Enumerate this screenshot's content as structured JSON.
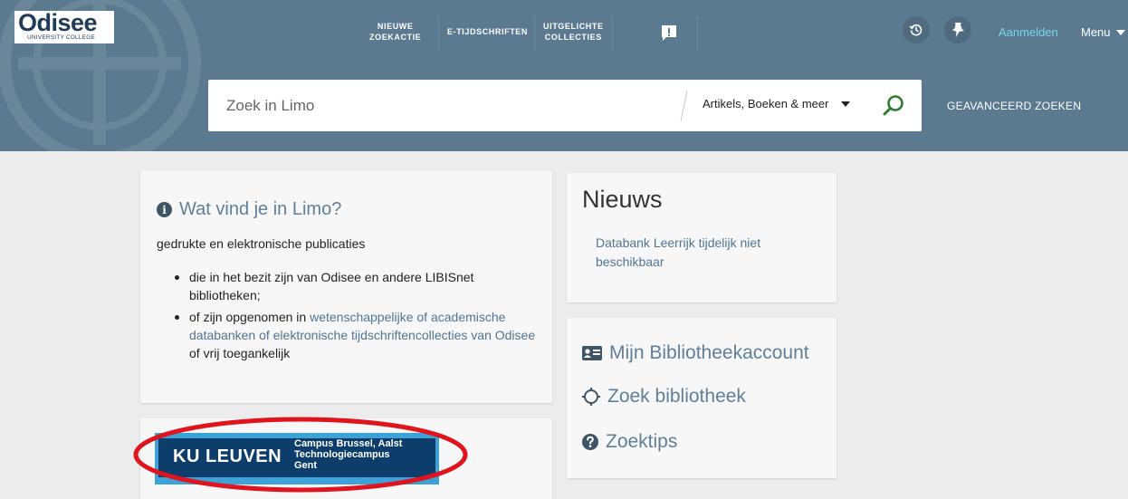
{
  "brand": {
    "logo_main": "Odisee",
    "logo_sub": "UNIVERSITY COLLEGE"
  },
  "topnav": {
    "new_search": [
      "NIEUWE",
      "ZOEKACTIE"
    ],
    "e_journals": "E-TIJDSCHRIFTEN",
    "highlighted": [
      "UITGELICHTE",
      "COLLECTIES"
    ],
    "login": "Aanmelden",
    "menu": "Menu"
  },
  "search": {
    "placeholder": "Zoek in Limo",
    "scope": "Artikels, Boeken & meer",
    "advanced": "GEAVANCEERD ZOEKEN"
  },
  "what_card": {
    "title": "Wat vind je in Limo?",
    "intro": "gedrukte en elektronische publicaties",
    "bullet1": "die in het bezit zijn van Odisee en andere LIBISnet bibliotheken;",
    "bullet2_prefix": "of zijn opgenomen in ",
    "bullet2_link": "wetenschappelijke of academische databanken of elektronische tijdschriftencollecties van Odisee",
    "bullet2_suffix": " of vrij toegankelijk"
  },
  "news_card": {
    "title": "Nieuws",
    "item": "Databank Leerrijk tijdelijk niet beschikbaar"
  },
  "quick_links": {
    "account": "Mijn Bibliotheekaccount",
    "find_library": "Zoek bibliotheek",
    "tips": "Zoektips"
  },
  "ku_banner": {
    "name": "KU LEUVEN",
    "line1": "Campus Brussel, Aalst",
    "line2": "Technologiecampus",
    "line3": "Gent"
  },
  "colors": {
    "header_bg": "#5b7a90",
    "accent_link": "#4f7595",
    "login_link": "#79d3e8",
    "search_icon": "#2e7d32",
    "annotation_oval": "#e0141c"
  },
  "icons": [
    "history-icon",
    "pin-icon",
    "feedback-icon",
    "search-icon",
    "info-icon",
    "id-card-icon",
    "crosshair-icon",
    "help-icon",
    "caret-down-icon"
  ]
}
